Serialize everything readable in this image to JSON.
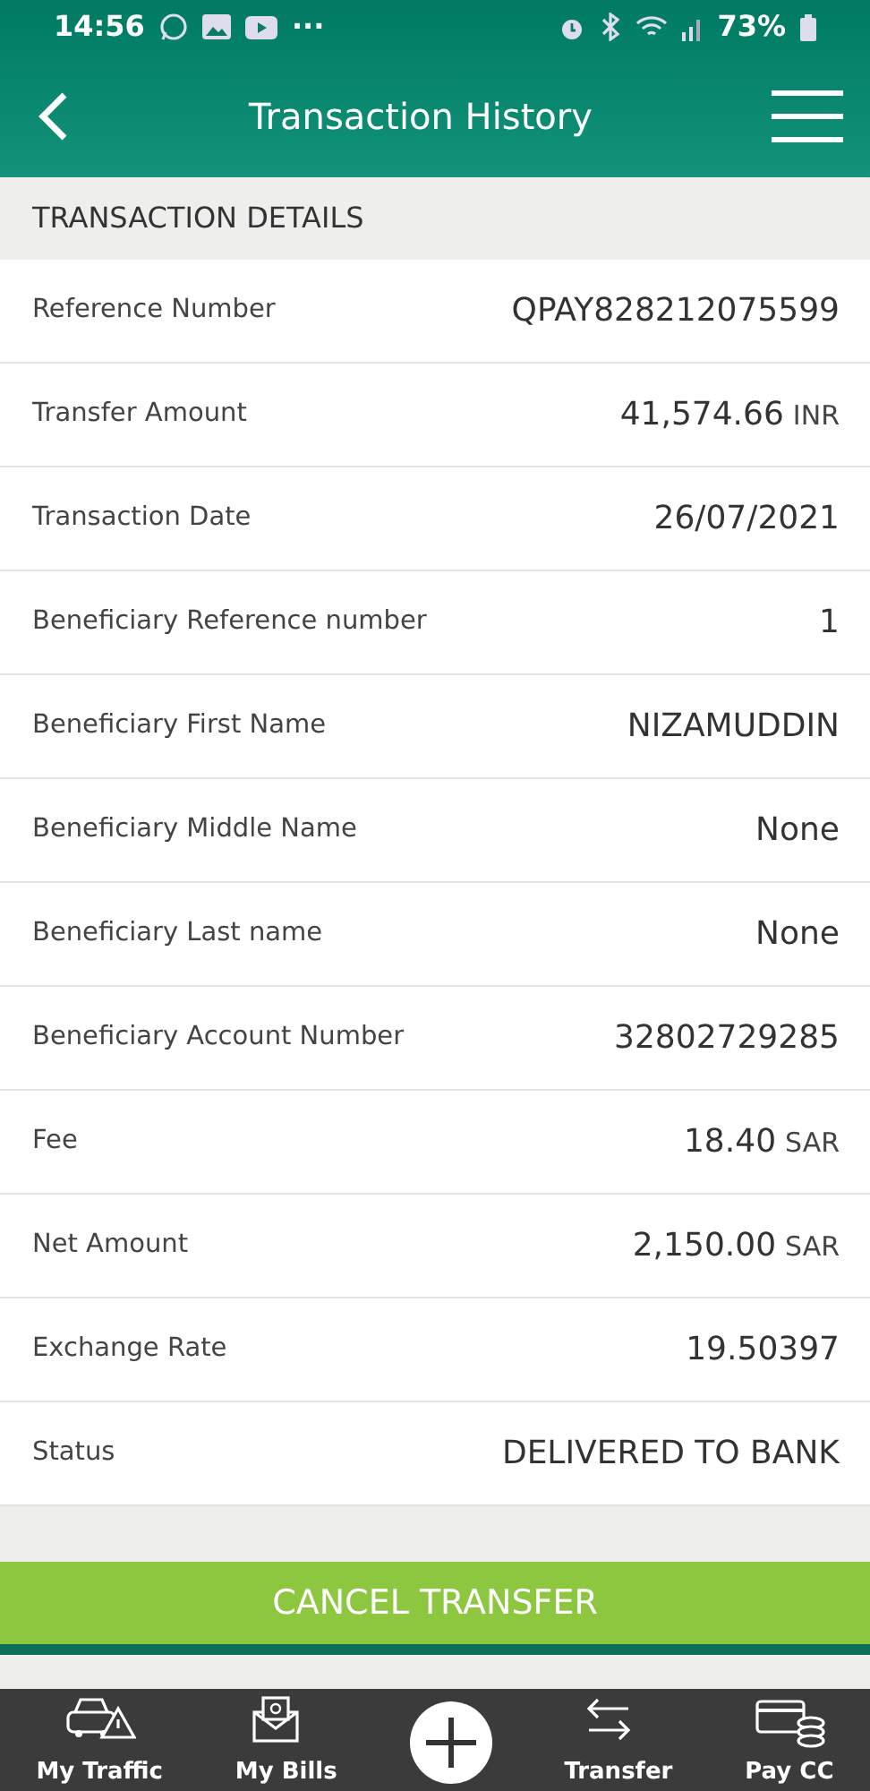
{
  "status_bar": {
    "time": "14:56",
    "more": "···",
    "battery": "73%"
  },
  "header": {
    "title": "Transaction History"
  },
  "section": {
    "title": "TRANSACTION DETAILS"
  },
  "rows": [
    {
      "label": "Reference Number",
      "value": "QPAY828212075599"
    },
    {
      "label": "Transfer Amount",
      "value": "41,574.66",
      "unit": "INR"
    },
    {
      "label": "Transaction Date",
      "value": "26/07/2021"
    },
    {
      "label": "Beneficiary Reference number",
      "value": "1"
    },
    {
      "label": "Beneficiary First Name",
      "value": "NIZAMUDDIN"
    },
    {
      "label": "Beneficiary Middle Name",
      "value": "None"
    },
    {
      "label": "Beneficiary Last name",
      "value": "None"
    },
    {
      "label": "Beneficiary Account Number",
      "value": "32802729285"
    },
    {
      "label": "Fee",
      "value": "18.40",
      "unit": "SAR"
    },
    {
      "label": "Net Amount",
      "value": "2,150.00",
      "unit": "SAR"
    },
    {
      "label": "Exchange Rate",
      "value": "19.50397"
    },
    {
      "label": "Status",
      "value": "DELIVERED TO BANK"
    }
  ],
  "cancel_button": {
    "label": "CANCEL TRANSFER"
  },
  "bottom_nav": [
    {
      "kind": "traffic",
      "label": "My Traffic"
    },
    {
      "kind": "bills",
      "label": "My Bills"
    },
    {
      "kind": "plus"
    },
    {
      "kind": "transfer",
      "label": "Transfer"
    },
    {
      "kind": "card",
      "label": "Pay CC"
    }
  ]
}
